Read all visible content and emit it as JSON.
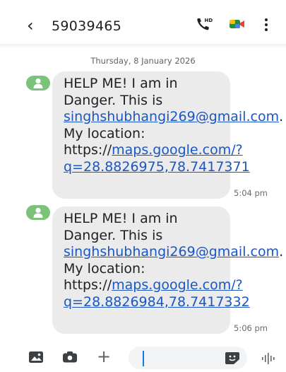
{
  "header": {
    "back_icon": "‹",
    "contact": "59039465",
    "hd_badge": "HD",
    "call_icon": "phone-hd-icon",
    "video_icon": "video-call-icon",
    "more_icon": "more-vertical-icon"
  },
  "date_separator": "Thursday, 8 January 2026",
  "messages": [
    {
      "text_prefix": "HELP ME! I am in Danger. This is ",
      "email": "singhshubhangi269@gmail.com",
      "text_mid": ". My location: https://",
      "link": "maps.google.com/?q=28.8826975,78.7417371",
      "time": "5:04 pm"
    },
    {
      "text_prefix": "HELP ME! I am in Danger. This is ",
      "email": "singhshubhangi269@gmail.com",
      "text_mid": ". My location: https://",
      "link": "maps.google.com/?q=28.8826984,78.7417332",
      "time": "5:06 pm"
    }
  ],
  "composer": {
    "gallery_icon": "gallery-icon",
    "camera_icon": "camera-icon",
    "plus_label": "+",
    "input_value": "",
    "sticker_icon": "sticker-icon",
    "voice_icon": "voice-record-icon"
  },
  "colors": {
    "bubble": "#ebebeb",
    "link": "#1a56c4",
    "avatar": "#7cc27a",
    "accent": "#1a73e8"
  }
}
